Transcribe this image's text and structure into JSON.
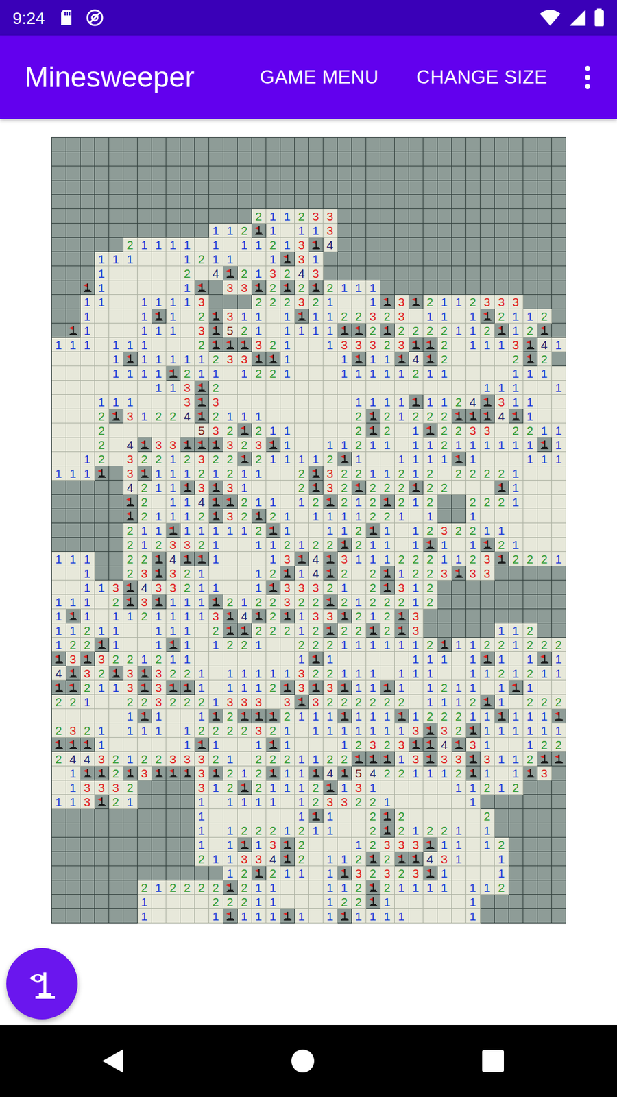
{
  "status_bar": {
    "time": "9:24"
  },
  "app_bar": {
    "title": "Minesweeper",
    "actions": [
      {
        "label": "GAME MENU"
      },
      {
        "label": "CHANGE SIZE"
      }
    ]
  },
  "board": {
    "rows": [
      "####################################",
      "####################################",
      "####################################",
      "####################################",
      "####################################",
      "##############211233################",
      "###########112F1.113################",
      "#####21111.1.11213F4################",
      "###111...1211..1F31#################",
      "###1.....2.4F213243#################",
      "##F1.....1F#33F2F2F2111#############",
      "##11..11113###222321..1F3F2112333###",
      "##1...1F1.2F311.1F1122323 11.1F2112##",
      "#F1...111.3F521.1111FF2F2222112F12F#",
      "111.111...2FFF321..133323FF2.1113F41",
      "....1F11111233FF1...1F11F4F2....2F2#",
      "....1111F211.1221...11111211....111.",
      ".......113F2..................111..111....",
      "...111...3F3.........1111F1124F311..",
      "...2F31224F2111......2F21222FFF4F1..",
      "...2......532F211....2F2.1F2233.2211",
      "...2.4F33FFF323F1..11211.112111111F1",
      "..12.32212322F211112F1..1111F1...111",
      "111F#3F11121211..2F32211212.22221...",
      "#####4211F3F31...2F32F222F22...F1...",
      "#####F2.114FF211.12F212F212##2221...",
      "#####F21112F32F21.1111221.1##1......",
      "#####211F111112F1..112F1.1232211....",
      "#####2123321..112122F211.1F1.1F21...",
      "111##22F4FF1...13F4F31112221123F2221",
      "..1##23F321...12F14F2.2F1223F33#####",
      "..113F433211..1F33321.2F312#########",
      "111.2F3F111F2122322F2122212#########",
      "1F1.11211113F4F2F133F212F3##########",
      "11211..111.2FF22212F22F2F3#####112##",
      "122F1..1F1.1221..2221111112F11221222",
      "F3F3221211.......1F1.....111.1F1.1F1",
      "4F32F3F3221.11111322111.111..1121211",
      "FF2113F3FF1.1112F3F3F11F1.1211.1F1..",
      "221..2232221333 3F3222222 1112F1.22211",
      ".....1F1..1F2FFF2111F111F122211F111F",
      "2321.111.12222321.11111113F32F111111",
      "FFF1.....1F1..1F1...12323FF4F31..122",
      "2443212233321.2221122FFF13F33F3112FF",
      ".1FF2F3FFF3F212F11F4F54221112F1.1F3#",
      ".13332####312F21112F131.....11212###",
      "113F21####1.1111.1233221.....1#####",
      "##########1......1F1..2F2.....2#####",
      "##########1.12221211..2F21221.1#####",
      "##########1.1F13F2...12333F11.12####",
      "##########211334F2.112F2FF431..1####",
      "############12F211.1F32323F1...1####",
      "######212222F211...112F21111.112####",
      "######1....22211...122F1.....1######",
      "######1....1F111F1.1F1111....1######"
    ]
  }
}
